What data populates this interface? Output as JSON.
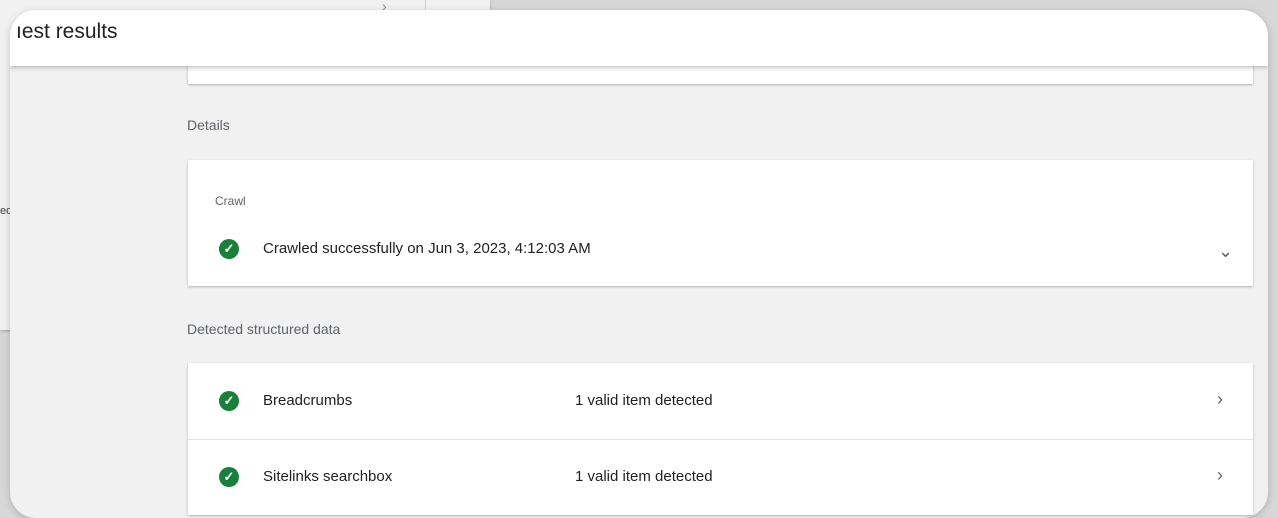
{
  "dialog": {
    "title": "est results",
    "title_prefix_fragment": "ı"
  },
  "details": {
    "label": "Details",
    "crawl": {
      "subtitle": "Crawl",
      "status": "Crawled successfully on Jun 3, 2023, 4:12:03 AM",
      "status_icon": "check-circle-icon",
      "expand_icon": "chevron-down-icon"
    }
  },
  "structured_data": {
    "label": "Detected structured data",
    "items": [
      {
        "name": "Breadcrumbs",
        "result": "1 valid item detected",
        "status_icon": "check-circle-icon"
      },
      {
        "name": "Sitelinks searchbox",
        "result": "1 valid item detected",
        "status_icon": "check-circle-icon"
      }
    ]
  },
  "background_fragment": {
    "text": "ed"
  },
  "colors": {
    "success": "#188038",
    "surface": "#ffffff",
    "page_background": "#f1f1f1",
    "secondary_text": "#5f6368"
  }
}
